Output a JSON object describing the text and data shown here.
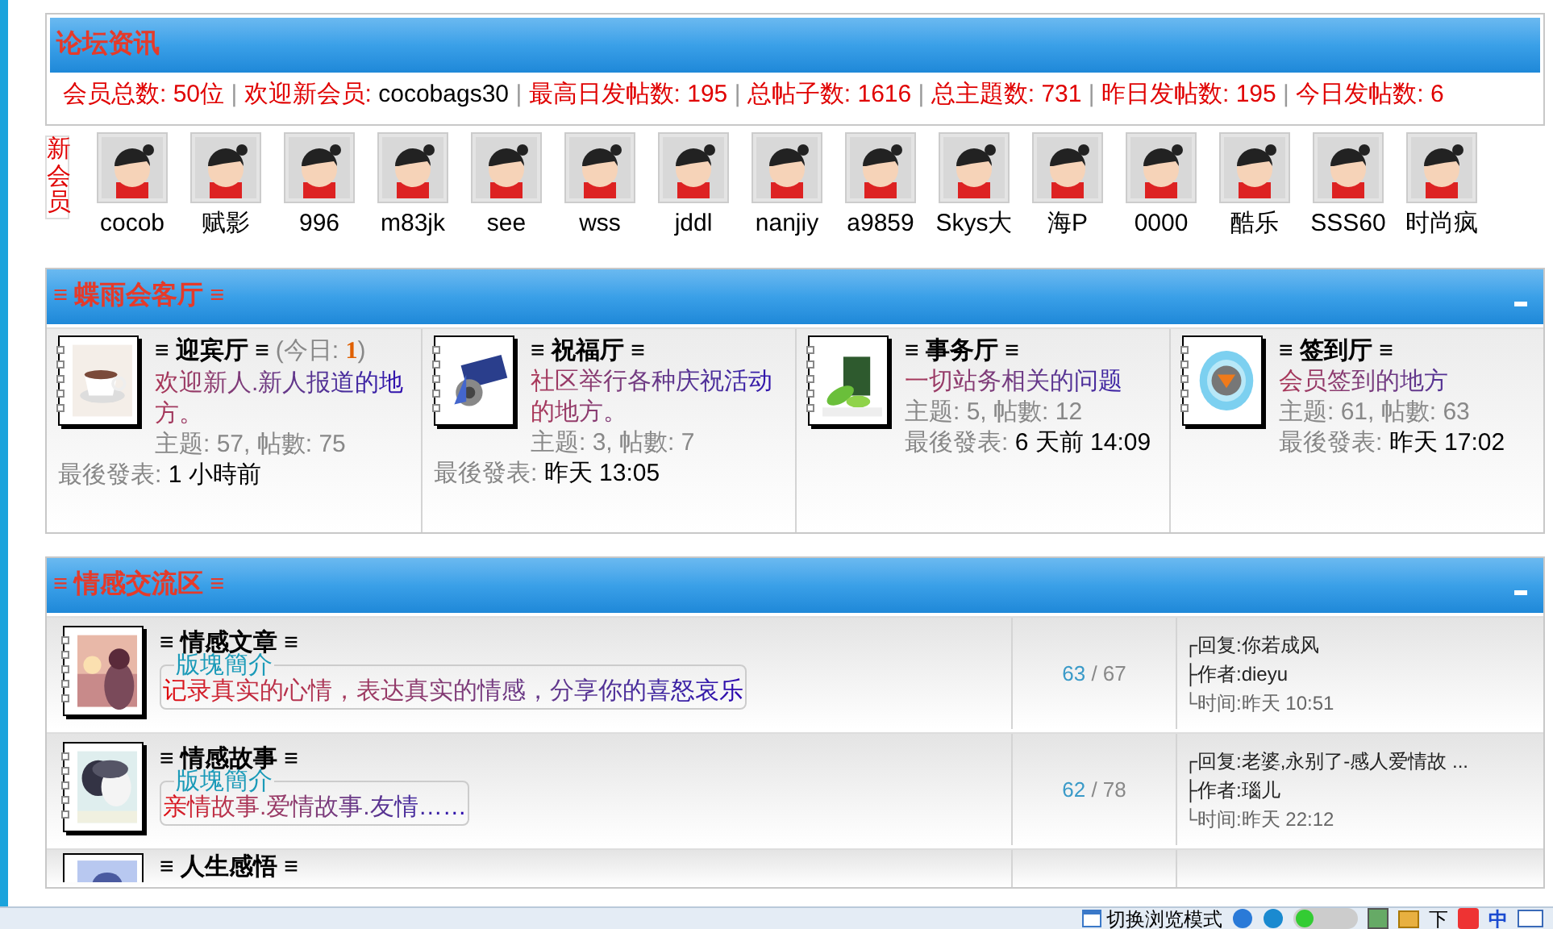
{
  "info": {
    "title": "论坛资讯",
    "stats": [
      {
        "label": "会员总数:",
        "value": "50位",
        "kind": "count"
      },
      {
        "label": "欢迎新会员:",
        "value": "cocobags30",
        "kind": "member"
      },
      {
        "label": "最高日发帖数:",
        "value": "195",
        "kind": "count"
      },
      {
        "label": "总帖子数:",
        "value": "1616",
        "kind": "count"
      },
      {
        "label": "总主題数:",
        "value": "731",
        "kind": "count"
      },
      {
        "label": "昨日发帖数:",
        "value": "195",
        "kind": "count"
      },
      {
        "label": "今日发帖数:",
        "value": "6",
        "kind": "count"
      }
    ],
    "separator": "|"
  },
  "new_members": {
    "label": "新会员",
    "members": [
      "cocob",
      "赋影",
      "996",
      "m83jk",
      "see",
      "wss",
      "jddl",
      "nanjiy",
      "a9859",
      "Skys大",
      "海P",
      "0000",
      "酷乐",
      "SSS60",
      "时尚疯"
    ]
  },
  "sections": [
    {
      "title": "≡ 蝶雨会客厅 ≡",
      "kind": "grid",
      "forums": [
        {
          "title": "≡ 迎宾厅 ≡",
          "today_label": "(今日: ",
          "today": "1",
          "today_end": ")",
          "description": "欢迎新人.新人报道的地方。",
          "stats": "主题: 57, 帖數: 75",
          "last_label": "最後發表:",
          "last": "1 小時前"
        },
        {
          "title": "≡ 祝福厅 ≡",
          "description": "社区举行各种庆祝活动的地方。",
          "stats": "主题: 3, 帖數: 7",
          "last_label": "最後發表:",
          "last": "昨天 13:05"
        },
        {
          "title": "≡ 事务厅 ≡",
          "description": "一切站务相关的问题",
          "stats": "主题: 5, 帖數: 12",
          "last_label": "最後發表:",
          "last": "6 天前 14:09"
        },
        {
          "title": "≡ 签到厅 ≡",
          "description": "会员签到的地方",
          "stats": "主题: 61, 帖數: 63",
          "last_label": "最後發表:",
          "last": "昨天 17:02"
        }
      ]
    },
    {
      "title": "≡ 情感交流区 ≡",
      "kind": "list",
      "forums": [
        {
          "title": "≡ 情感文章 ≡",
          "legend": "版塊簡介",
          "description": "记录真实的心情，表达真实的情感，分享你的喜怒哀乐",
          "topics": "63",
          "posts": "67",
          "separator": "/",
          "reply": "┌回复:你若成风",
          "author": "├作者:dieyu",
          "time": "└时间:昨天 10:51"
        },
        {
          "title": "≡ 情感故事 ≡",
          "legend": "版塊簡介",
          "description": "亲情故事.爱情故事.友情……",
          "topics": "62",
          "posts": "78",
          "separator": "/",
          "reply": "┌回复:老婆,永别了-感人爱情故 ...",
          "author": "├作者:瑙儿",
          "time": "└时间:昨天 22:12"
        },
        {
          "title": "≡ 人生感悟 ≡"
        }
      ]
    }
  ],
  "status_bar": {
    "mode_label": "切换浏览模式",
    "download": "下",
    "ime": "中"
  }
}
